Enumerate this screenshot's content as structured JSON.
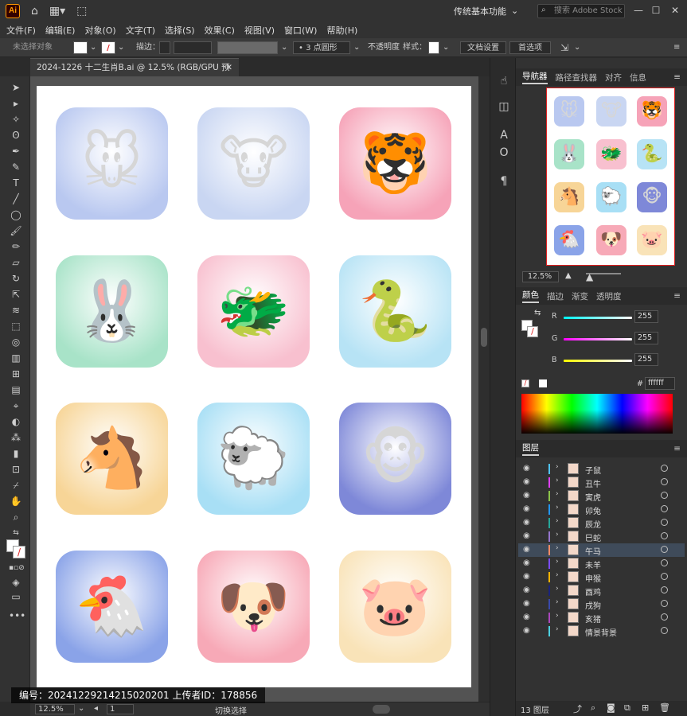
{
  "app": {
    "logo": "Ai",
    "workspace": "传统基本功能",
    "search_placeholder": "搜索 Adobe Stock"
  },
  "menu": [
    "文件(F)",
    "编辑(E)",
    "对象(O)",
    "文字(T)",
    "选择(S)",
    "效果(C)",
    "视图(V)",
    "窗口(W)",
    "帮助(H)"
  ],
  "control": {
    "selection": "未选择对象",
    "stroke_label": "描边：",
    "brush": "3 点圆形",
    "opacity_label": "不透明度",
    "style_label": "样式：",
    "doc_setup": "文档设置",
    "prefs": "首选项"
  },
  "document": {
    "tab_title": "2024-1226 十二生肖B.ai @ 12.5% (RGB/GPU 预览)"
  },
  "status": {
    "zoom": "12.5%",
    "artboard": "1",
    "hint": "切换选择"
  },
  "watermark": {
    "text": "编号：20241229214215020201   上传者ID：178856"
  },
  "panels": {
    "navigator_tabs": [
      "导航器",
      "路径查找器",
      "对齐",
      "信息"
    ],
    "nav_zoom": "12.5%",
    "color_tabs": [
      "颜色",
      "描边",
      "渐变",
      "透明度"
    ],
    "rgb": {
      "r_label": "R",
      "g_label": "G",
      "b_label": "B",
      "r": "255",
      "g": "255",
      "b": "255",
      "hex_prefix": "#",
      "hex": "ffffff"
    },
    "layers_title": "图层",
    "layers_count": "13 图层",
    "layers": [
      "子鼠",
      "丑牛",
      "寅虎",
      "卯兔",
      "辰龙",
      "巳蛇",
      "午马",
      "未羊",
      "申猴",
      "酉鸡",
      "戌狗",
      "亥猪",
      "情景背景"
    ]
  },
  "colors": {
    "accent": "#e02020",
    "panel": "#323232",
    "canvas": "#535353"
  },
  "tiles": [
    {
      "icon": "🐭",
      "bg": "#b9c8f0"
    },
    {
      "icon": "🐮",
      "bg": "#c9d6f2"
    },
    {
      "icon": "🐯",
      "bg": "#f6a3b8"
    },
    {
      "icon": "🐰",
      "bg": "#a8e3c8"
    },
    {
      "icon": "🐲",
      "bg": "#f8c0cf"
    },
    {
      "icon": "🐍",
      "bg": "#b7e3f5"
    },
    {
      "icon": "🐴",
      "bg": "#f7d597"
    },
    {
      "icon": "🐑",
      "bg": "#a8dff5"
    },
    {
      "icon": "🐵",
      "bg": "#7e88d8"
    },
    {
      "icon": "🐔",
      "bg": "#8aa3e8"
    },
    {
      "icon": "🐶",
      "bg": "#f7a9b7"
    },
    {
      "icon": "🐷",
      "bg": "#f9e3b8"
    }
  ]
}
